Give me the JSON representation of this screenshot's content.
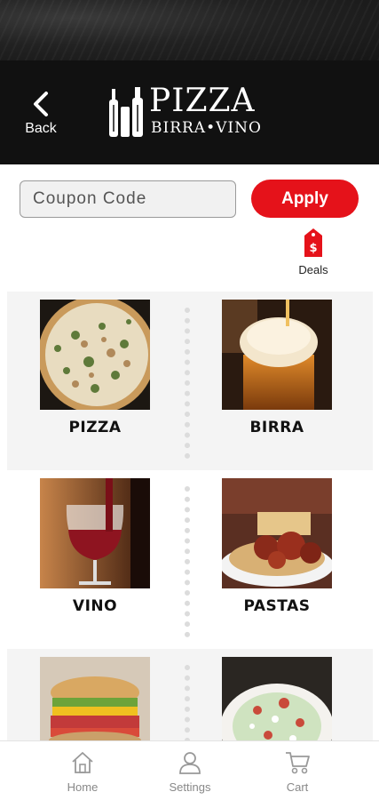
{
  "header": {
    "back_label": "Back",
    "logo_title": "PIZZA",
    "logo_subtitle": "BIRRA•VINO"
  },
  "coupon": {
    "placeholder": "Coupon Code",
    "apply_label": "Apply"
  },
  "deals": {
    "label": "Deals",
    "icon": "price-tag-icon"
  },
  "menu": {
    "items": [
      {
        "label": "PIZZA",
        "image": "pizza-photo"
      },
      {
        "label": "BIRRA",
        "image": "beer-photo"
      },
      {
        "label": "VINO",
        "image": "wine-photo"
      },
      {
        "label": "PASTAS",
        "image": "pasta-photo"
      },
      {
        "label": "",
        "image": "sandwich-photo"
      },
      {
        "label": "",
        "image": "salad-photo"
      }
    ]
  },
  "tabbar": {
    "items": [
      {
        "label": "Home",
        "icon": "home-icon"
      },
      {
        "label": "Settings",
        "icon": "user-icon"
      },
      {
        "label": "Cart",
        "icon": "cart-icon"
      }
    ]
  },
  "colors": {
    "accent": "#e5121a",
    "header_bg": "#111111",
    "row_shade": "#f4f4f4",
    "tab_inactive": "#888888"
  }
}
